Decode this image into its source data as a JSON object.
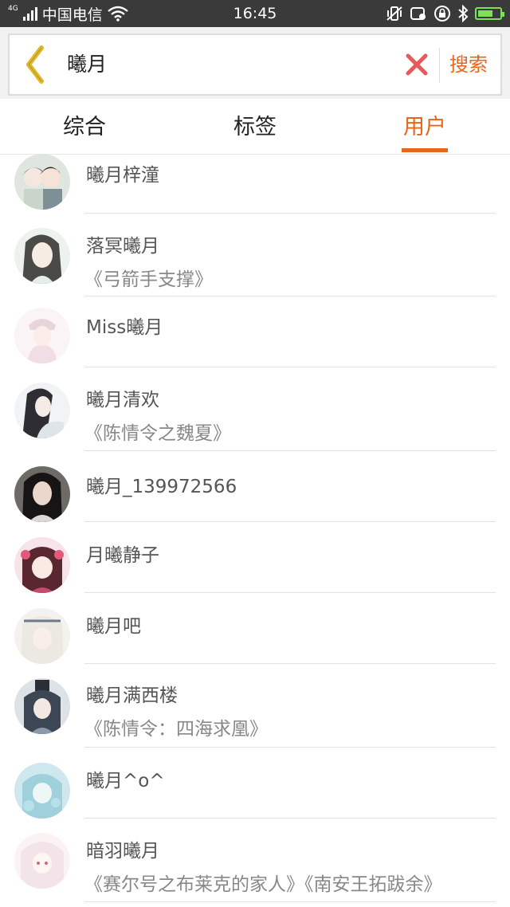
{
  "status_bar": {
    "network": "4G",
    "carrier": "中国电信",
    "time": "16:45",
    "battery_level": 0.6,
    "icons": [
      "signal-icon",
      "wifi-icon",
      "vibrate-icon",
      "screenshot-icon",
      "rotation-lock-icon",
      "bluetooth-icon",
      "battery-icon"
    ]
  },
  "search": {
    "query": "曦月",
    "submit_label": "搜索"
  },
  "tabs": [
    {
      "label": "综合",
      "active": false
    },
    {
      "label": "标签",
      "active": false
    },
    {
      "label": "用户",
      "active": true
    }
  ],
  "colors": {
    "accent": "#e8651a",
    "clear": "#e85a5a",
    "back_arrow": "#e0b92a"
  },
  "users": [
    {
      "name": "曦月梓潼",
      "works": ""
    },
    {
      "name": "落冥曦月",
      "works": "《弓箭手支撑》"
    },
    {
      "name": "Miss曦月",
      "works": ""
    },
    {
      "name": "曦月清欢",
      "works": "《陈情令之魏夏》"
    },
    {
      "name": "曦月_139972566",
      "works": ""
    },
    {
      "name": "月曦静子",
      "works": ""
    },
    {
      "name": "曦月吧",
      "works": ""
    },
    {
      "name": "曦月满西楼",
      "works": "《陈情令：四海求凰》"
    },
    {
      "name": "曦月^o^",
      "works": ""
    },
    {
      "name": "暗羽曦月",
      "works": "《赛尔号之布莱克的家人》《南安王拓跋余》"
    }
  ]
}
